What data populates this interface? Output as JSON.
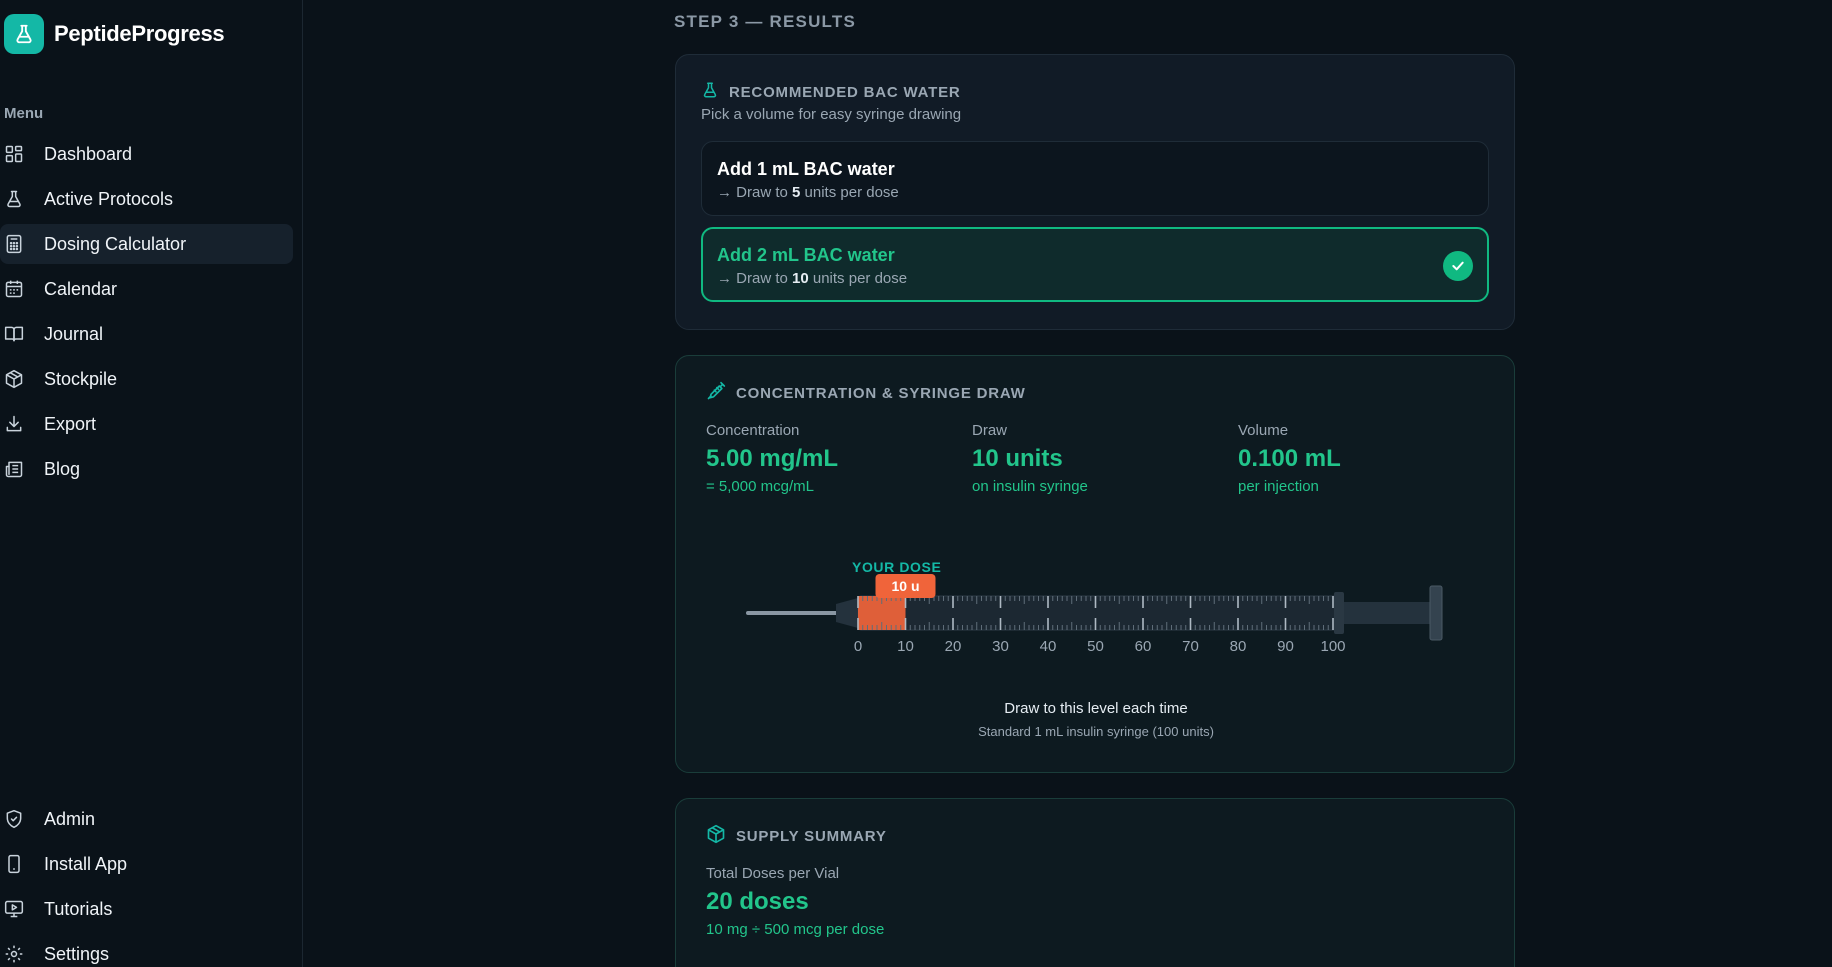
{
  "brand": {
    "name": "PeptideProgress"
  },
  "sidebar": {
    "menu_label": "Menu",
    "items": [
      {
        "label": "Dashboard",
        "icon": "dashboard-icon"
      },
      {
        "label": "Active Protocols",
        "icon": "flask-icon"
      },
      {
        "label": "Dosing Calculator",
        "icon": "calculator-icon",
        "active": true
      },
      {
        "label": "Calendar",
        "icon": "calendar-icon"
      },
      {
        "label": "Journal",
        "icon": "book-icon"
      },
      {
        "label": "Stockpile",
        "icon": "box-icon"
      },
      {
        "label": "Export",
        "icon": "download-icon"
      },
      {
        "label": "Blog",
        "icon": "newspaper-icon"
      }
    ],
    "bottom_items": [
      {
        "label": "Admin",
        "icon": "shield-icon"
      },
      {
        "label": "Install App",
        "icon": "phone-icon"
      },
      {
        "label": "Tutorials",
        "icon": "video-icon"
      },
      {
        "label": "Settings",
        "icon": "gear-icon"
      }
    ]
  },
  "step": {
    "title": "STEP 3 — RESULTS"
  },
  "bac": {
    "title": "RECOMMENDED BAC WATER",
    "subtitle": "Pick a volume for easy syringe drawing",
    "options": [
      {
        "title": "Add 1 mL BAC water",
        "prefix": "→ Draw to ",
        "units": "5",
        "suffix": " units per dose",
        "selected": false
      },
      {
        "title": "Add 2 mL BAC water",
        "prefix": "→ Draw to ",
        "units": "10",
        "suffix": " units per dose",
        "selected": true
      }
    ]
  },
  "concentration": {
    "title": "CONCENTRATION & SYRINGE DRAW",
    "stats": [
      {
        "label": "Concentration",
        "value": "5.00 mg/mL",
        "sub": "= 5,000 mcg/mL"
      },
      {
        "label": "Draw",
        "value": "10 units",
        "sub": "on insulin syringe"
      },
      {
        "label": "Volume",
        "value": "0.100 mL",
        "sub": "per injection"
      }
    ],
    "syringe": {
      "dose_label": "YOUR DOSE",
      "badge": "10 u",
      "dose_units": 10,
      "max_units": 100,
      "ticks": [
        "0",
        "10",
        "20",
        "30",
        "40",
        "50",
        "60",
        "70",
        "80",
        "90",
        "100"
      ]
    },
    "note": "Draw to this level each time",
    "note_sub": "Standard 1 mL insulin syringe (100 units)"
  },
  "supply": {
    "title": "SUPPLY SUMMARY",
    "label": "Total Doses per Vial",
    "value": "20 doses",
    "sub": "10 mg ÷ 500 mcg per dose"
  },
  "colors": {
    "accent": "#22c58b",
    "teal": "#14b8a6",
    "dose": "#f0643a"
  }
}
